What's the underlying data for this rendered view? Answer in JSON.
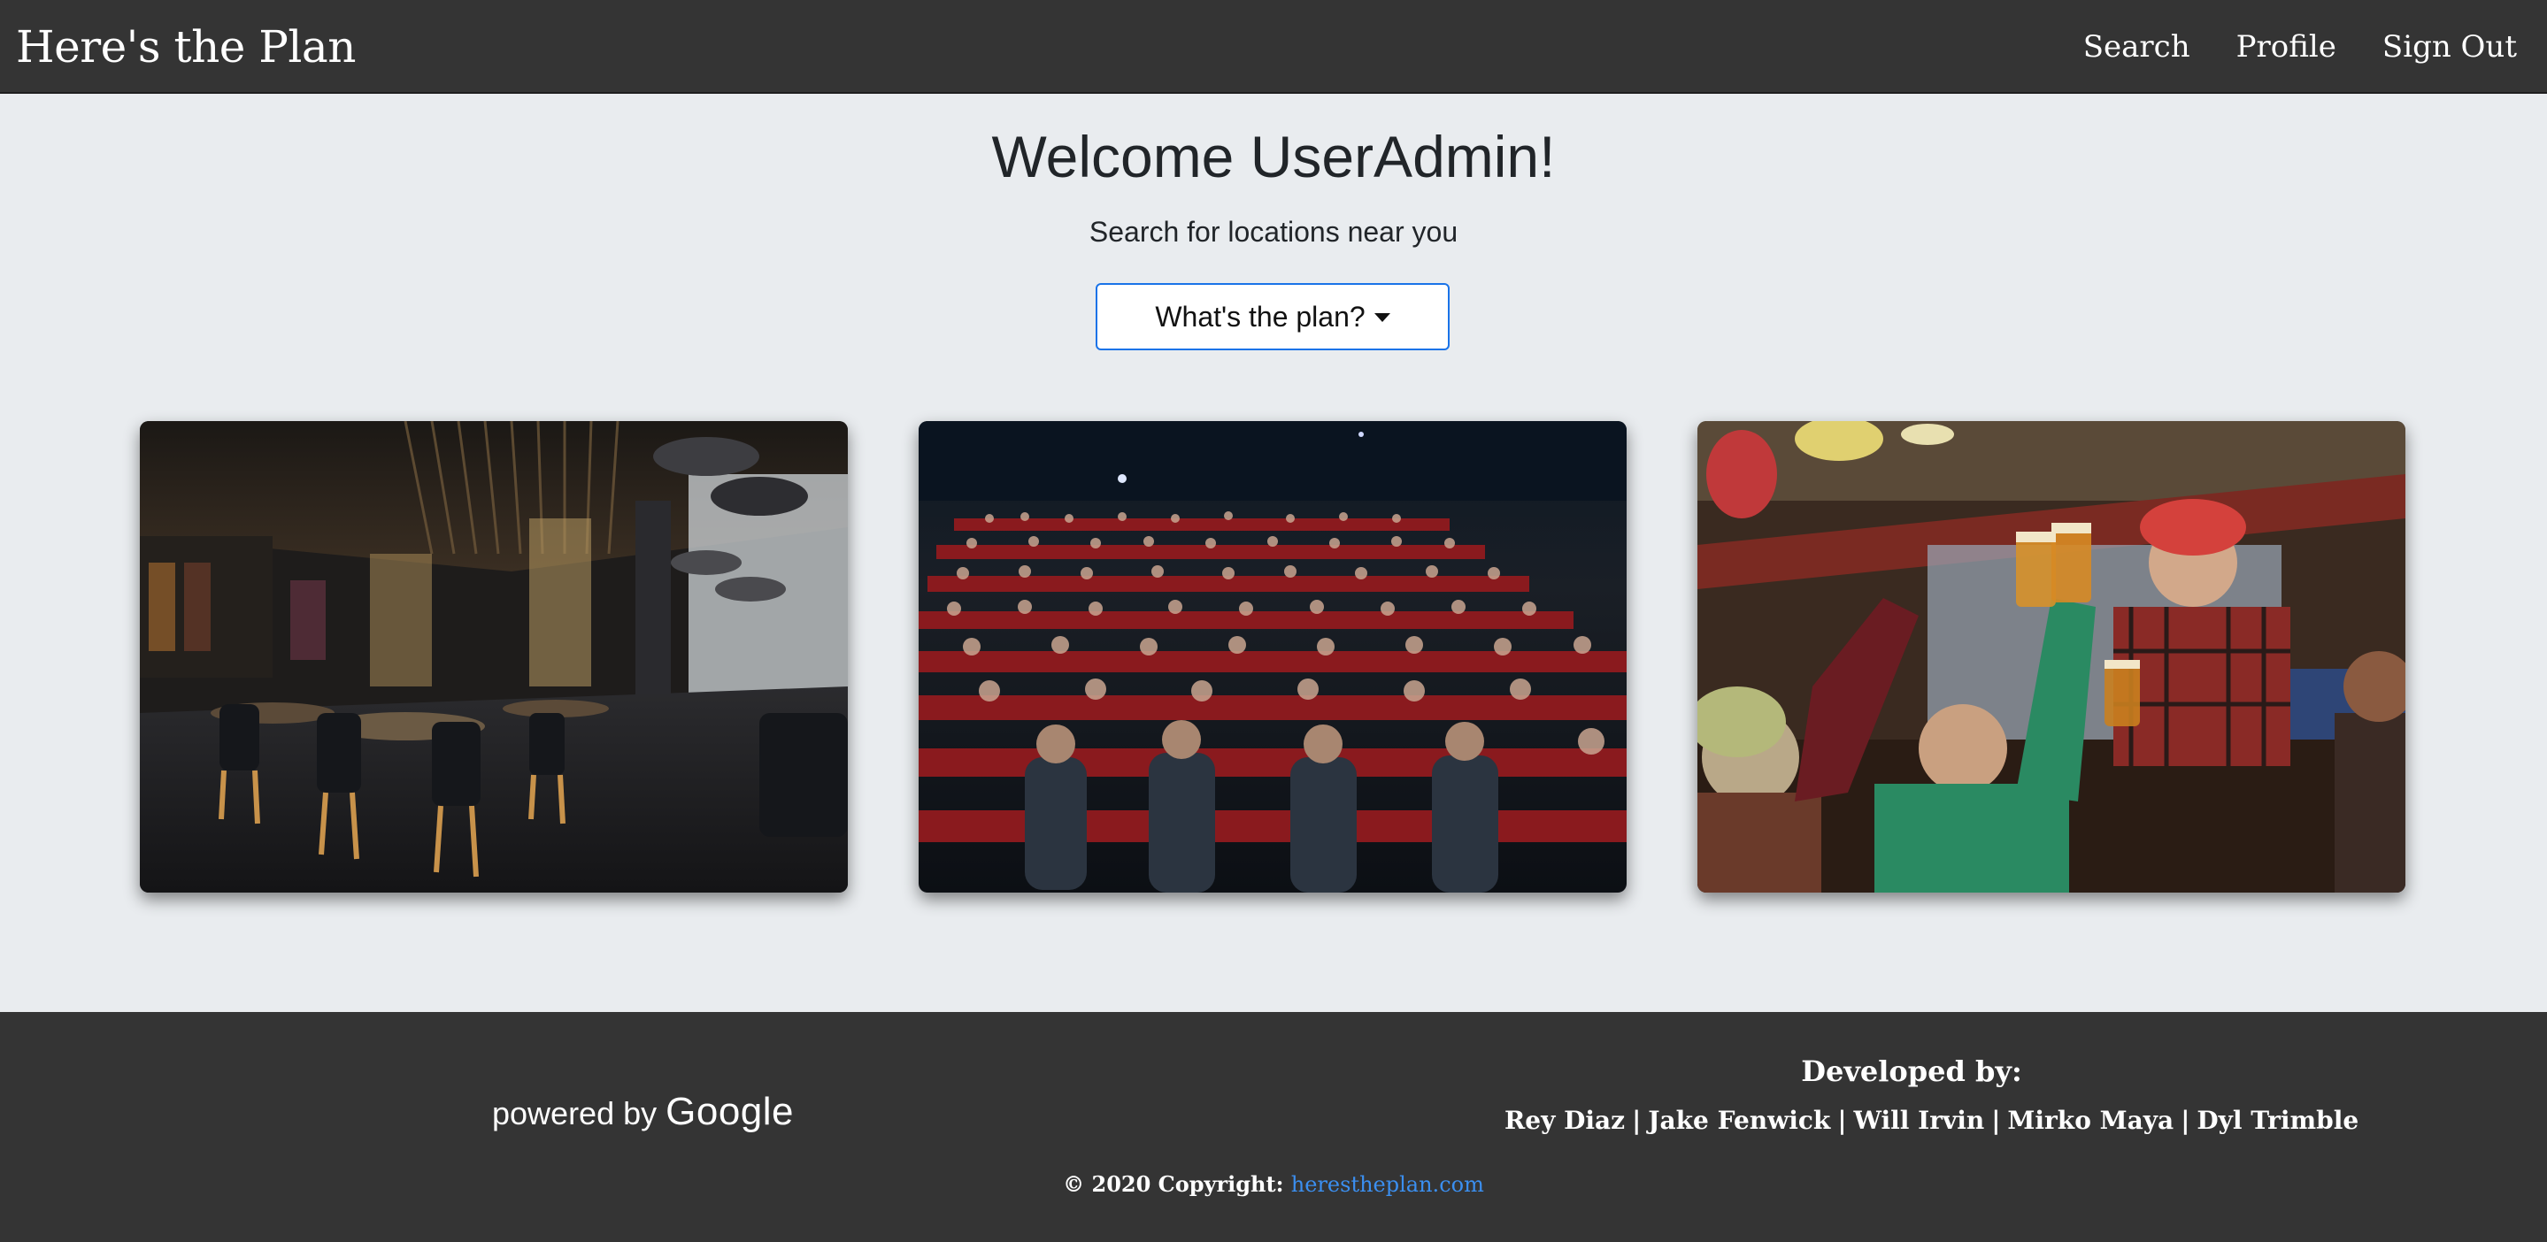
{
  "navbar": {
    "brand": "Here's the Plan",
    "links": [
      "Search",
      "Profile",
      "Sign Out"
    ]
  },
  "hero": {
    "title": "Welcome UserAdmin!",
    "subtitle": "Search for locations near you",
    "dropdown_label": "What's the plan?"
  },
  "cards": [
    {
      "image": "restaurant-interior-photo"
    },
    {
      "image": "movie-theater-audience-photo"
    },
    {
      "image": "friends-toasting-beers-photo"
    }
  ],
  "footer": {
    "powered_by": "powered by",
    "google": "Google",
    "developed_by": "Developed by:",
    "developers": [
      "Rey Diaz",
      "Jake Fenwick",
      "Will Irvin",
      "Mirko Maya",
      "Dyl Trimble"
    ],
    "separator": "|",
    "copyright_prefix": "© 2020 Copyright:",
    "copyright_link": "herestheplan.com"
  },
  "colors": {
    "navbar_bg": "#343434",
    "page_bg": "#e9ecef",
    "accent": "#1a73e8",
    "link": "#3b8ff0"
  }
}
